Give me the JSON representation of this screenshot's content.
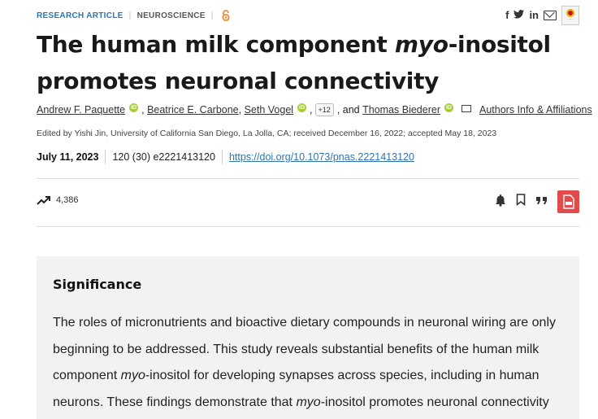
{
  "meta": {
    "article_type": "RESEARCH ARTICLE",
    "subject": "NEUROSCIENCE",
    "open_access_icon": "open-access-lock-icon"
  },
  "share_icons": [
    "facebook-icon",
    "twitter-icon",
    "linkedin-icon",
    "email-icon",
    "crossmark-badge-icon"
  ],
  "title": {
    "part1": "The human milk component ",
    "italic": "myo",
    "part2": "-inositol promotes neuronal connectivity"
  },
  "authors": {
    "a1": "Andrew F. Paquette",
    "a2": "Beatrice E. Carbone",
    "a3": "Seth Vogel",
    "more": "+12",
    "and_text": ", and",
    "a4": "Thomas Biederer",
    "affiliations_link": "Authors Info & Affiliations"
  },
  "edited_line": "Edited by Yishi Jin, University of California San Diego, La Jolla, CA; received December 16, 2022; accepted May 18, 2023",
  "publication": {
    "date": "July 11, 2023",
    "citation": "120 (30) e2221413120",
    "doi": "https://doi.org/10.1073/pnas.2221413120"
  },
  "metrics": {
    "views": "4,386",
    "icon": "trending-up-icon"
  },
  "tools": [
    "alert-bell-icon",
    "bookmark-icon",
    "cite-quote-icon",
    "pdf-icon"
  ],
  "significance": {
    "heading": "Significance",
    "text1": "The roles of micronutrients and bioactive dietary compounds in neuronal wiring are only beginning to be addressed. This study reveals substantial benefits of the human milk component ",
    "italic1": "myo",
    "text2": "-inositol for developing synapses across species, including in human neurons. These findings demonstrate that ",
    "italic2": "myo",
    "text3": "-inositol promotes neuronal connectivity"
  },
  "colors": {
    "link": "#2f74b0",
    "orcid": "#a6ce39",
    "pdf": "#e34b4b",
    "significance_bg": "#f2f2f2"
  }
}
